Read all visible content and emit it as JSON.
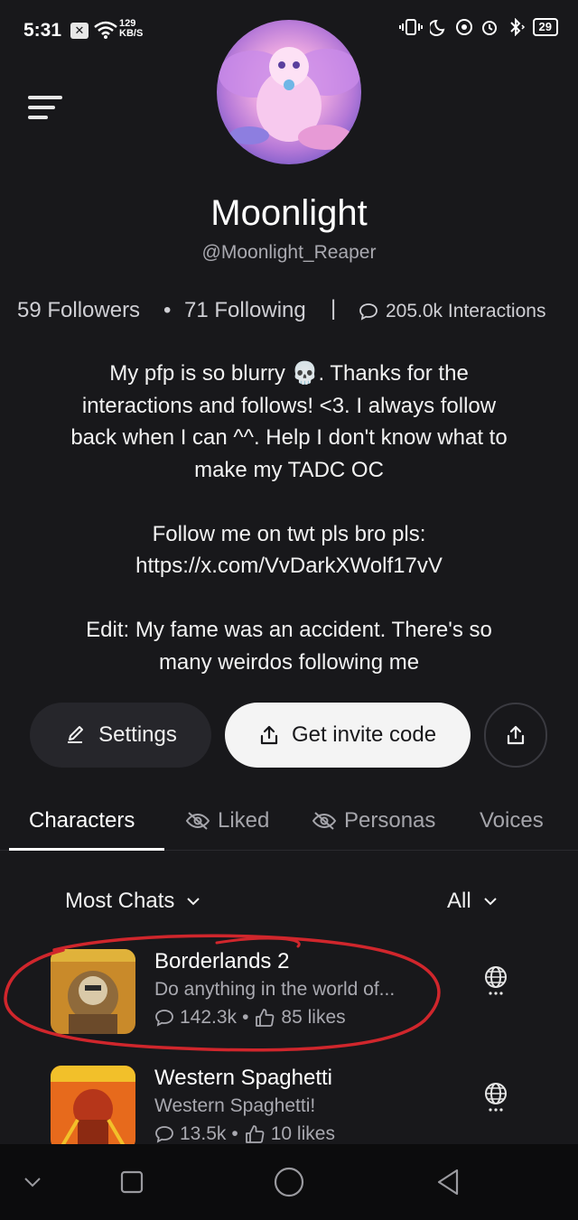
{
  "status_bar": {
    "time": "5:31",
    "notification_badge": "✕",
    "net_speed_value": "129",
    "net_speed_unit": "KB/S",
    "battery": "29"
  },
  "profile": {
    "display_name": "Moonlight",
    "handle": "@Moonlight_Reaper",
    "followers": "59 Followers",
    "dot": "•",
    "following": "71 Following",
    "separator": "|",
    "interactions": "205.0k Interactions",
    "bio": "My pfp is so blurry 💀. Thanks for the\ninteractions and follows! <3. I always follow\nback when I can ^^. Help I don't know what to\nmake my TADC OC\n\nFollow me on twt pls bro pls:\nhttps://x.com/VvDarkXWolf17vV\n\nEdit: My fame was an accident. There's so\nmany weirdos following me"
  },
  "actions": {
    "settings_label": "Settings",
    "invite_label": "Get invite code"
  },
  "tabs": [
    {
      "label": "Characters",
      "active": true
    },
    {
      "label": "Liked",
      "active": false
    },
    {
      "label": "Personas",
      "active": false
    },
    {
      "label": "Voices",
      "active": false
    }
  ],
  "filters": {
    "sort_label": "Most Chats",
    "scope_label": "All"
  },
  "characters": [
    {
      "title": "Borderlands 2",
      "description": "Do anything in the world of...",
      "chats": "142.3k",
      "likes": "85 likes"
    },
    {
      "title": "Western Spaghetti",
      "description": "Western Spaghetti!",
      "chats": "13.5k",
      "likes": "10 likes"
    }
  ],
  "colors": {
    "background": "#18181b",
    "annotation_red": "#d0262c",
    "invite_button_bg": "#f4f4f4"
  },
  "icons": {
    "menu": "hamburger-menu-icon",
    "settings": "pencil-icon",
    "invite": "share-upload-icon",
    "share": "share-upload-icon",
    "hidden_tab": "eye-off-icon",
    "dropdown": "chevron-down-icon",
    "visibility": "globe-icon"
  }
}
